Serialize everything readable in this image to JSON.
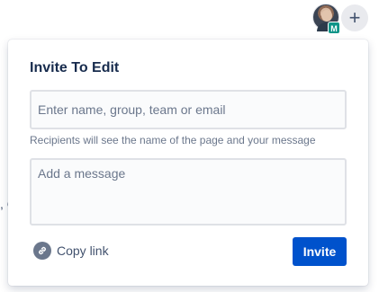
{
  "header": {
    "avatar_badge": "M",
    "add_button_label": "+"
  },
  "background": {
    "peek_text": ", C"
  },
  "invite_dialog": {
    "title": "Invite To Edit",
    "recipients": {
      "value": "",
      "placeholder": "Enter name, group, team or email"
    },
    "helper_text": "Recipients will see the name of the page and your message",
    "message": {
      "value": "",
      "placeholder": "Add a message"
    },
    "copy_link_label": "Copy link",
    "copy_link_icon": "link-icon",
    "invite_button_label": "Invite",
    "colors": {
      "primary": "#0052cc",
      "badge": "#0d9488"
    }
  }
}
